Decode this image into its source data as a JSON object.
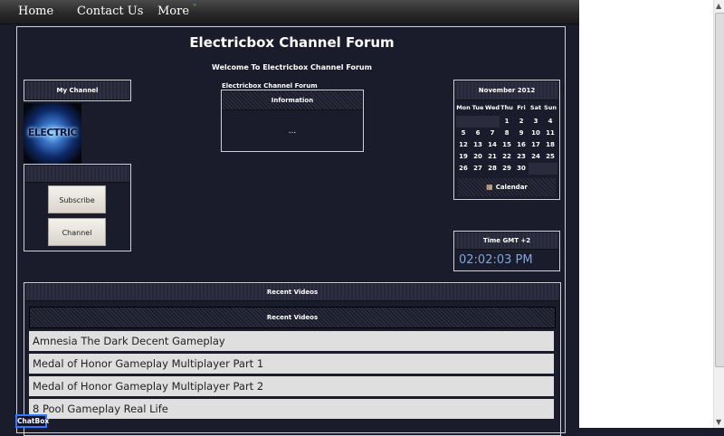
{
  "nav": {
    "items": [
      "Home",
      "Contact Us",
      "More"
    ]
  },
  "forum": {
    "title": "Electricbox Channel Forum",
    "welcome": "Welcome To Electricbox Channel Forum"
  },
  "my_channel": {
    "title": "My Channel",
    "logo_text": "ELECTRIC",
    "buttons": [
      "Subscribe",
      "Channel"
    ]
  },
  "information": {
    "caption": "Electricbox Channel Forum",
    "title": "Information",
    "body": "..."
  },
  "calendar": {
    "month": "November 2012",
    "weekdays": [
      "Mon",
      "Tue",
      "Wed",
      "Thu",
      "Fri",
      "Sat",
      "Sun"
    ],
    "leading_blanks": 3,
    "days": 30,
    "footer": "Calendar"
  },
  "time": {
    "title": "Time GMT +2",
    "value": "02:02:03 PM"
  },
  "recent_videos": {
    "title": "Recent Videos",
    "subtitle": "Recent Videos",
    "items": [
      "Amnesia The Dark Decent Gameplay",
      "Medal of Honor Gameplay Multiplayer Part 1",
      "Medal of Honor Gameplay Multiplayer Part 2",
      "8 Pool Gameplay Real Life"
    ]
  },
  "chatbox": {
    "label": "ChatBox"
  },
  "colors": {
    "background": "#1b1c2b",
    "border": "#cfd0d8",
    "clock": "#7fa6d8",
    "chatbox_border": "#2f78ff"
  }
}
